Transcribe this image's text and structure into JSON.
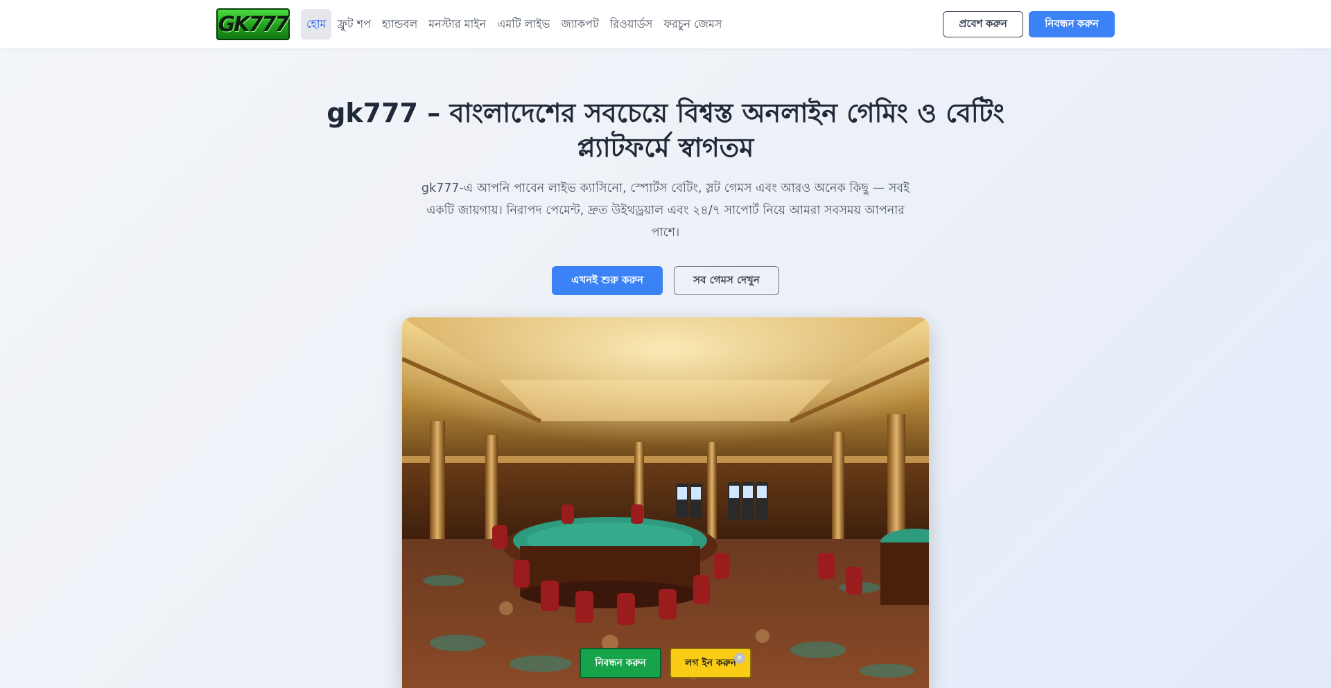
{
  "header": {
    "logo_text": "GK777",
    "nav": [
      {
        "label": "হোম",
        "active": true
      },
      {
        "label": "ফ্রুট শপ"
      },
      {
        "label": "হ্যান্ডবল"
      },
      {
        "label": "মনস্টার মাইন"
      },
      {
        "label": "এমটি লাইভ"
      },
      {
        "label": "জ্যাকপট"
      },
      {
        "label": "রিওয়ার্ডস"
      },
      {
        "label": "ফরচুন জেমস"
      }
    ],
    "login_label": "প্রবেশ করুন",
    "register_label": "নিবন্ধন করুন"
  },
  "hero": {
    "title": "gk777 – বাংলাদেশের সবচেয়ে বিশ্বস্ত অনলাইন গেমিং ও বেটিং প্ল্যাটফর্মে স্বাগতম",
    "description": "gk777-এ আপনি পাবেন লাইভ ক্যাসিনো, স্পোর্টস বেটিং, স্লট গেমস এবং আরও অনেক কিছু — সবই একটি জায়গায়। নিরাপদ পেমেন্ট, দ্রুত উইথড্রয়াল এবং ২৪/৭ সাপোর্ট নিয়ে আমরা সবসময় আপনার পাশে।",
    "cta_primary": "এখনই শুরু করুন",
    "cta_secondary": "সব গেমস দেখুন"
  },
  "floating_bar": {
    "register_label": "নিবন্ধন করুন",
    "login_label": "লগ ইন করুন",
    "close_icon": "close-icon"
  },
  "colors": {
    "primary": "#3b82f6",
    "float_register": "#16a34a",
    "float_login": "#facc15"
  }
}
